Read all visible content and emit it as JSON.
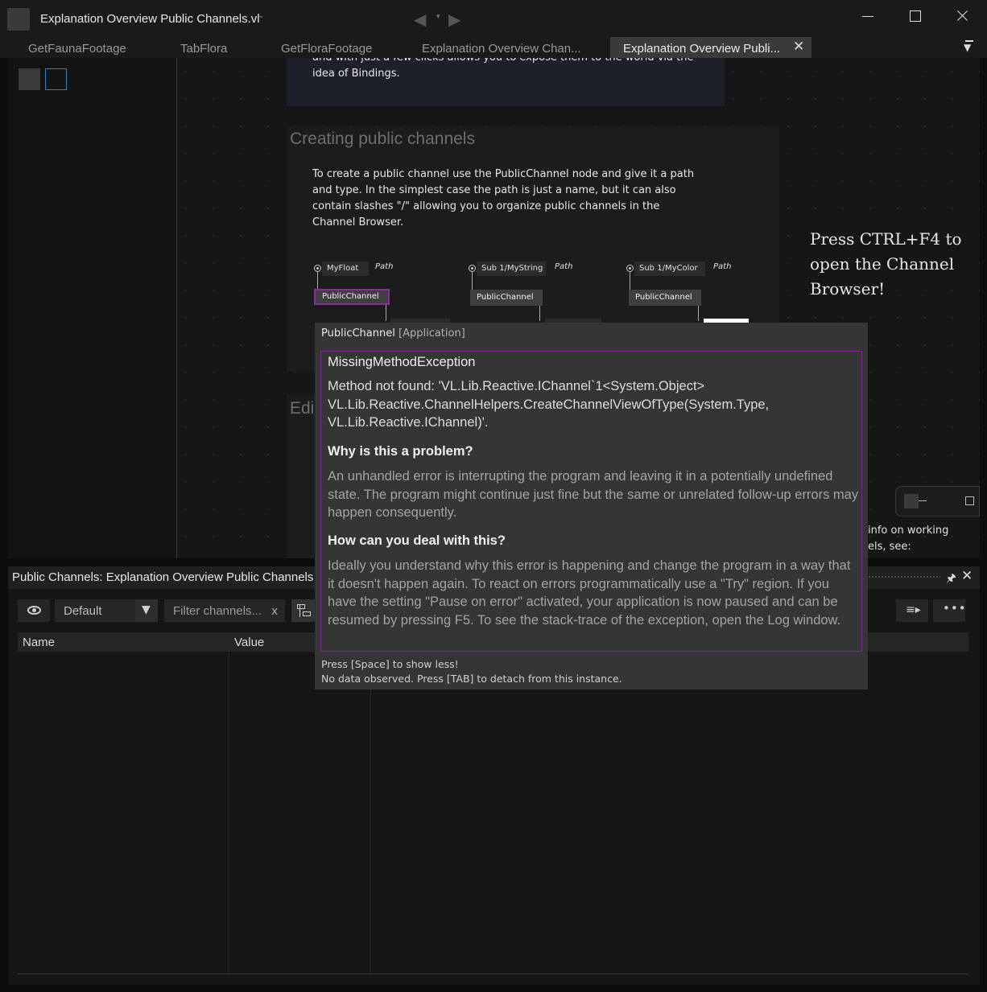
{
  "window": {
    "title": "Explanation Overview Public Channels.vl",
    "title_dropdown_glyph": "⌄",
    "nav_back_glyph": "◀",
    "nav_dropdown_glyph": "▾",
    "nav_forward_glyph": "▶"
  },
  "tabs": [
    {
      "label": "GetFaunaFootage"
    },
    {
      "label": "TabFlora"
    },
    {
      "label": "GetFloraFootage"
    },
    {
      "label": "Explanation Overview Chan..."
    },
    {
      "label": "Explanation Overview Publi...",
      "active": true
    }
  ],
  "tab_close_glyph": "✕",
  "tabs_menu_glyph": "▼",
  "patch": {
    "intro_text": "and with just a few clicks allows you to expose them to the world via the idea of Bindings.",
    "create_heading": "Creating public channels",
    "create_text": "To create a public channel use the PublicChannel node and give it a path and type. In the simplest case the path is just a name, but it can also contain slashes \"/\" allowing you to organize public channels in the Channel Browser.",
    "nodes": [
      {
        "iobox": "MyFloat",
        "path_label": "Path",
        "node": "PublicChannel",
        "error": true
      },
      {
        "iobox": "Sub 1/MyString",
        "path_label": "Path",
        "node": "PublicChannel",
        "error": false
      },
      {
        "iobox": "Sub 1/MyColor",
        "path_label": "Path",
        "node": "PublicChannel",
        "error": false
      }
    ],
    "edit_heading": "Edi",
    "hint": "Press CTRL+F4 to open the Channel Browser!",
    "info_line1": "info on working",
    "info_line2": "els, see:"
  },
  "bottom_panel": {
    "title": "Public Channels: Explanation Overview Public Channels",
    "pin_glyph": "🖈",
    "close_glyph": "✕",
    "preset": "Default",
    "preset_arrow_glyph": "▼",
    "filter_placeholder": "Filter channels...",
    "filter_clear": "x",
    "playlist_glyph": "≡▸",
    "more_glyph": "•••",
    "columns": [
      "Name",
      "Value"
    ]
  },
  "tooltip": {
    "node_name": "PublicChannel",
    "node_context": "[Application]",
    "exception": "MissingMethodException",
    "message": "Method not found: 'VL.Lib.Reactive.IChannel`1<System.Object> VL.Lib.Reactive.ChannelHelpers.CreateChannelViewOfType(System.Type, VL.Lib.Reactive.IChannel)'.",
    "why_heading": "Why is this a problem?",
    "why_text": "An unhandled error is interrupting the program and leaving it in a potentially undefined state. The program might continue just fine but the same or unrelated follow-up errors may happen consequently.",
    "how_heading": "How can you deal with this?",
    "how_text": "Ideally you understand why this error is happening and change the program in a way that it doesn't happen again. To react on errors programmatically use a \"Try\" region. If you have the setting \"Pause on error\" activated, your application is now paused and can be resumed by pressing F5. To see the stack-trace of the exception, open the Log window.",
    "footer_1": "Press [Space] to show less!",
    "footer_2": "No data observed. Press [TAB] to detach from this instance."
  },
  "colors": {
    "error_accent": "#8a2b9c",
    "selection_blue": "#3d7fb5",
    "background": "#161616"
  },
  "icons": [
    "app-icon",
    "back-arrow-icon",
    "forward-arrow-icon",
    "minimize-icon",
    "maximize-icon",
    "close-icon",
    "eye-icon",
    "tree-icon",
    "pin-icon",
    "more-icon"
  ]
}
